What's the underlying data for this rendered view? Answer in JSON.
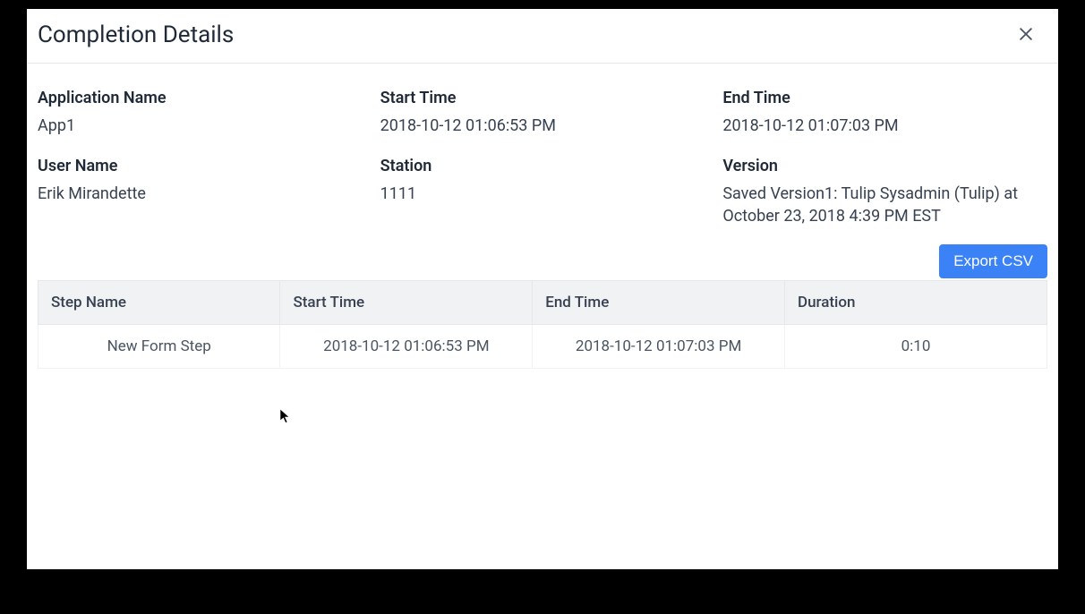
{
  "modal": {
    "title": "Completion Details"
  },
  "details": {
    "application_name": {
      "label": "Application Name",
      "value": "App1"
    },
    "start_time": {
      "label": "Start Time",
      "value": "2018-10-12 01:06:53 PM"
    },
    "end_time": {
      "label": "End Time",
      "value": "2018-10-12 01:07:03 PM"
    },
    "user_name": {
      "label": "User Name",
      "value": "Erik Mirandette"
    },
    "station": {
      "label": "Station",
      "value": "1111"
    },
    "version": {
      "label": "Version",
      "value": "Saved Version1: Tulip Sysadmin (Tulip) at October 23, 2018 4:39 PM EST"
    }
  },
  "actions": {
    "export_csv": "Export CSV"
  },
  "table": {
    "headers": {
      "step_name": "Step Name",
      "start_time": "Start Time",
      "end_time": "End Time",
      "duration": "Duration"
    },
    "rows": [
      {
        "step_name": "New Form Step",
        "start_time": "2018-10-12 01:06:53 PM",
        "end_time": "2018-10-12 01:07:03 PM",
        "duration": "0:10"
      }
    ]
  }
}
